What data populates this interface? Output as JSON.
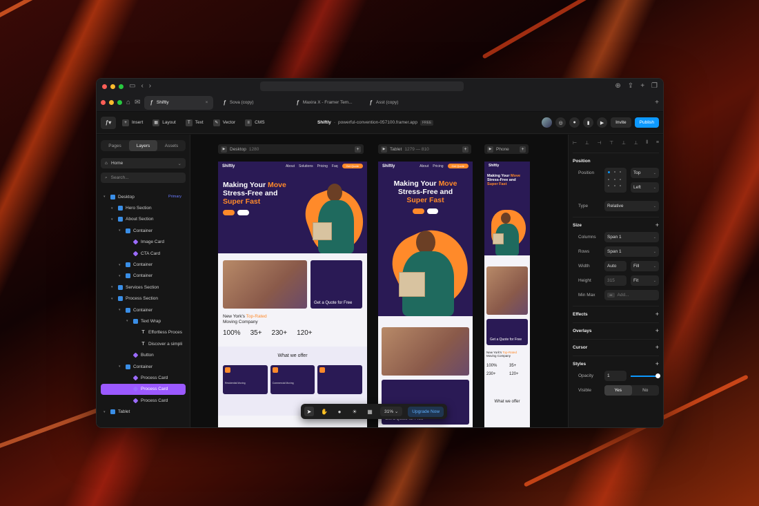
{
  "browser": {
    "tabs": [
      {
        "label": "Shiftly",
        "active": true
      },
      {
        "label": "Sova (copy)",
        "active": false
      },
      {
        "label": "Maxira X - Framer Tem...",
        "active": false
      },
      {
        "label": "Asst (copy)",
        "active": false
      }
    ]
  },
  "toolbar": {
    "insert": "Insert",
    "layout": "Layout",
    "text": "Text",
    "vector": "Vector",
    "cms": "CMS",
    "project_name": "Shiftly",
    "separator": "·",
    "domain": "powerful-convention-057100.framer.app",
    "plan": "FREE",
    "invite": "Invite",
    "publish": "Publish"
  },
  "left_panel": {
    "tabs": [
      "Pages",
      "Layers",
      "Assets"
    ],
    "active_tab": "Layers",
    "page_select": "Home",
    "search_placeholder": "Search...",
    "layers": [
      {
        "label": "Desktop",
        "type": "frame",
        "depth": 0,
        "caret": true,
        "badge": "Primary"
      },
      {
        "label": "Hero Section",
        "type": "frame",
        "depth": 1,
        "caret": true
      },
      {
        "label": "About Section",
        "type": "frame",
        "depth": 1,
        "caret": true
      },
      {
        "label": "Container",
        "type": "frame",
        "depth": 2,
        "caret": true
      },
      {
        "label": "Image Card",
        "type": "comp",
        "depth": 3,
        "caret": false
      },
      {
        "label": "CTA Card",
        "type": "comp",
        "depth": 3,
        "caret": false
      },
      {
        "label": "Container",
        "type": "frame",
        "depth": 2,
        "caret": true
      },
      {
        "label": "Container",
        "type": "frame",
        "depth": 2,
        "caret": true
      },
      {
        "label": "Services Section",
        "type": "frame",
        "depth": 1,
        "caret": true
      },
      {
        "label": "Process Section",
        "type": "frame",
        "depth": 1,
        "caret": true
      },
      {
        "label": "Container",
        "type": "frame",
        "depth": 2,
        "caret": true
      },
      {
        "label": "Text Wrap",
        "type": "frame",
        "depth": 3,
        "caret": true
      },
      {
        "label": "Effortless Proces",
        "type": "text",
        "depth": 4,
        "caret": false
      },
      {
        "label": "Discover a simpli",
        "type": "text",
        "depth": 4,
        "caret": false
      },
      {
        "label": "Button",
        "type": "comp",
        "depth": 3,
        "caret": false
      },
      {
        "label": "Container",
        "type": "frame",
        "depth": 2,
        "caret": true
      },
      {
        "label": "Process Card",
        "type": "comp",
        "depth": 3,
        "caret": false
      },
      {
        "label": "Process Card",
        "type": "comp",
        "depth": 3,
        "caret": false,
        "selected": true
      },
      {
        "label": "Process Card",
        "type": "comp",
        "depth": 3,
        "caret": false
      },
      {
        "label": "Tablet",
        "type": "frame",
        "depth": 0,
        "caret": true
      }
    ]
  },
  "canvas": {
    "frames": [
      {
        "name": "Desktop",
        "size": "1280"
      },
      {
        "name": "Tablet",
        "size": "1279 — 810"
      },
      {
        "name": "Phone",
        "size": ""
      }
    ],
    "site": {
      "brand": "Shiftly",
      "nav": [
        "About",
        "Solutions",
        "Pricing",
        "Faq"
      ],
      "nav_cta": "Get Quote",
      "hero_line1": "Making Your ",
      "hero_accent1": "Move",
      "hero_line2": "Stress-Free and",
      "hero_accent2": "Super Fast",
      "quote_card": "Get a Quote for Free",
      "about_line1": "New York's ",
      "about_accent": "Top-Rated",
      "about_line2": "Moving Company",
      "stats": [
        "100%",
        "35+",
        "230+",
        "120+"
      ],
      "offer_title": "What we offer",
      "services": [
        "Residential Moving",
        "Commercial Moving",
        "",
        ""
      ]
    },
    "zoom": "31%",
    "upgrade": "Upgrade Now"
  },
  "right_panel": {
    "position_title": "Position",
    "position_label": "Position",
    "vertical": "Top",
    "horizontal": "Left",
    "type_label": "Type",
    "type_value": "Relative",
    "size_title": "Size",
    "columns_label": "Columns",
    "columns_value": "Span 1",
    "rows_label": "Rows",
    "rows_value": "Span 1",
    "width_label": "Width",
    "width_value": "Auto",
    "width_mode": "Fill",
    "height_label": "Height",
    "height_value": "315",
    "height_mode": "Fit",
    "minmax_label": "Min Max",
    "minmax_placeholder": "Add...",
    "effects": "Effects",
    "overlays": "Overlays",
    "cursor": "Cursor",
    "styles": "Styles",
    "opacity_label": "Opacity",
    "opacity_value": "1",
    "visible_label": "Visible",
    "visible_yes": "Yes",
    "visible_no": "No"
  }
}
